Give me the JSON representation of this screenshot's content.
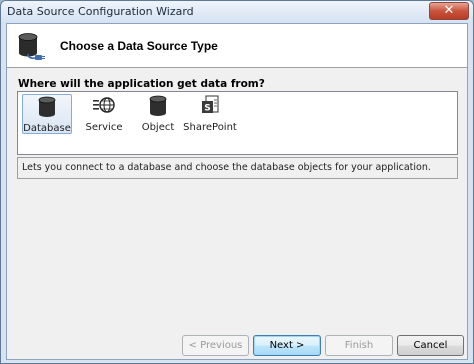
{
  "window": {
    "title": "Data Source Configuration Wizard",
    "close_glyph": "✕"
  },
  "header": {
    "title": "Choose a Data Source Type",
    "icon": "database-plug-icon"
  },
  "question": "Where will the application get data from?",
  "types": [
    {
      "label": "Database",
      "icon": "database-icon",
      "selected": true
    },
    {
      "label": "Service",
      "icon": "service-icon",
      "selected": false
    },
    {
      "label": "Object",
      "icon": "object-icon",
      "selected": false
    },
    {
      "label": "SharePoint",
      "icon": "sharepoint-icon",
      "selected": false
    }
  ],
  "description": "Lets you connect to a database and choose the database objects for your application.",
  "buttons": {
    "previous": "< Previous",
    "next": "Next >",
    "finish": "Finish",
    "cancel": "Cancel"
  },
  "colors": {
    "selection_border": "#84acdd",
    "title_bar": "#d5e2f1",
    "close_button": "#c9533c"
  }
}
